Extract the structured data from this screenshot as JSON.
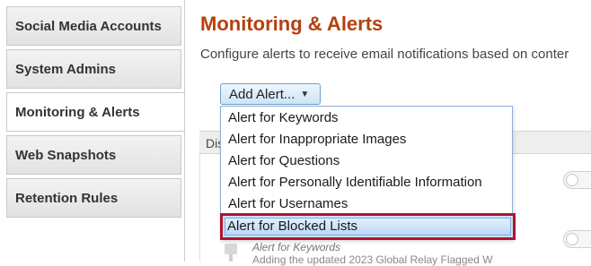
{
  "sidebar": {
    "items": [
      {
        "label": "Social Media Accounts",
        "active": false
      },
      {
        "label": "System Admins",
        "active": false
      },
      {
        "label": "Monitoring & Alerts",
        "active": true
      },
      {
        "label": "Web Snapshots",
        "active": false
      },
      {
        "label": "Retention Rules",
        "active": false
      }
    ]
  },
  "main": {
    "title": "Monitoring & Alerts",
    "description": "Configure alerts to receive email notifications based on conter",
    "add_button_label": "Add Alert...",
    "table_header": "Dis",
    "row": {
      "type_label": "Alert for Keywords",
      "text": "Adding the updated 2023 Global Relay Flagged W"
    }
  },
  "dropdown": {
    "options": [
      "Alert for Keywords",
      "Alert for Inappropriate Images",
      "Alert for Questions",
      "Alert for Personally Identifiable Information",
      "Alert for Usernames",
      "Alert for Blocked Lists"
    ],
    "highlighted_index": 5
  },
  "colors": {
    "title": "#b5400e",
    "highlight_border": "#b3132b",
    "button_border": "#6f9fcc"
  }
}
